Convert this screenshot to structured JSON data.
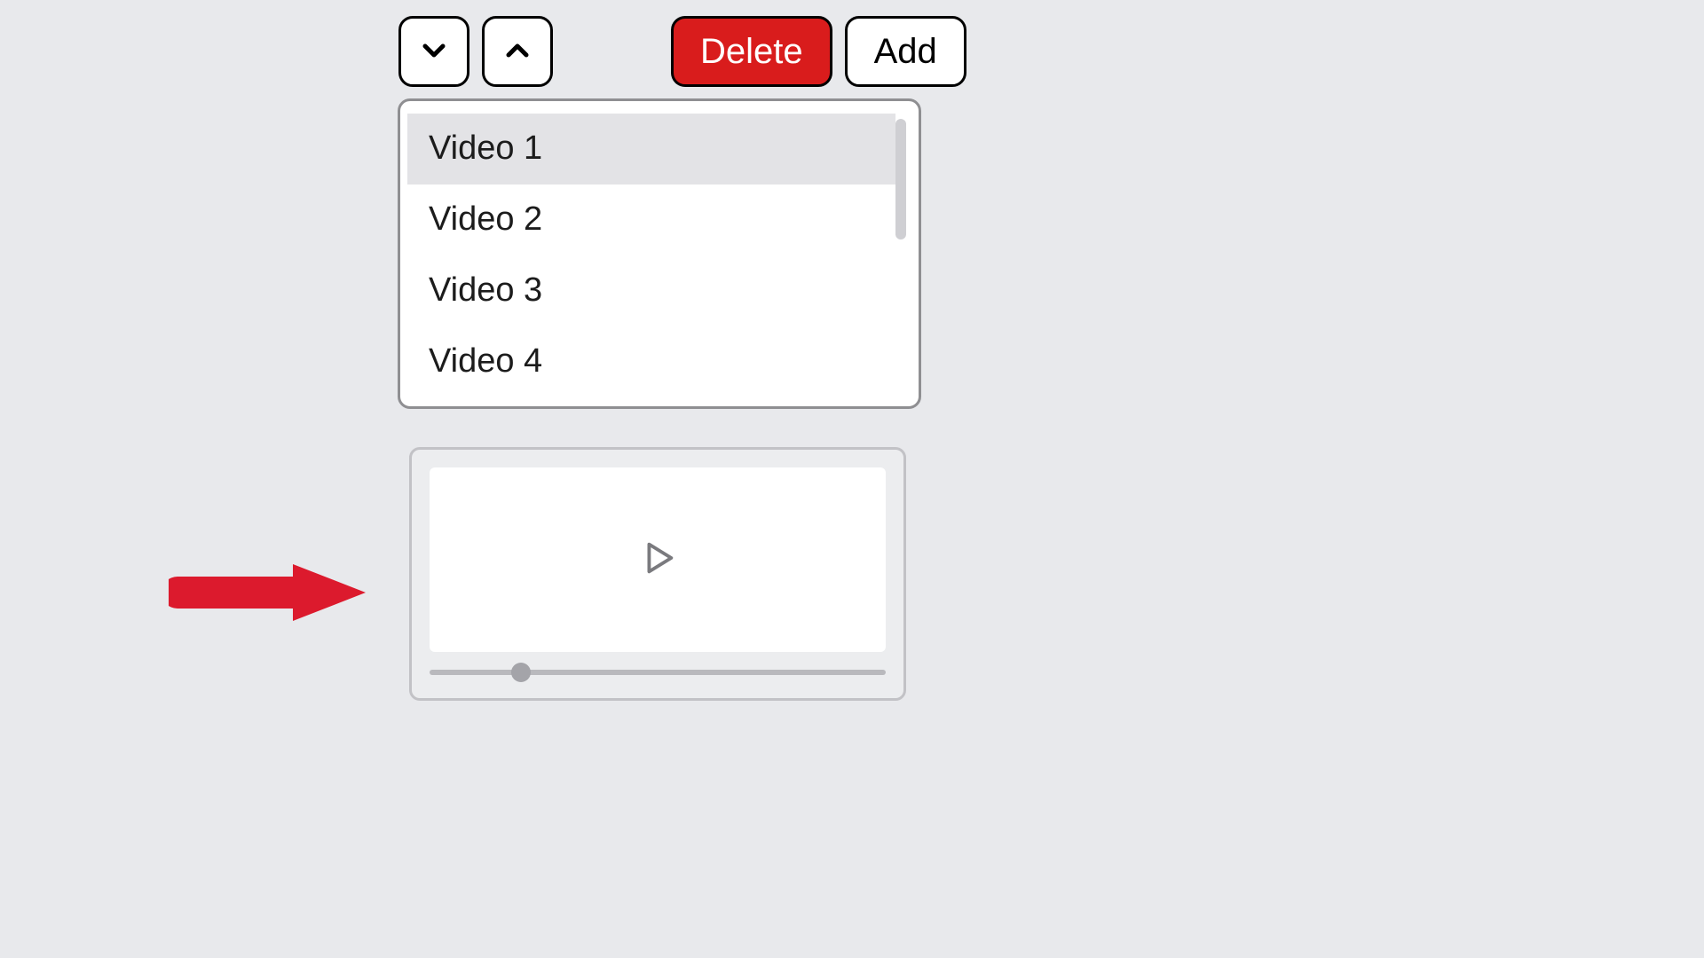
{
  "toolbar": {
    "delete_label": "Delete",
    "add_label": "Add"
  },
  "playlist": {
    "items": [
      {
        "label": "Video 1",
        "selected": true
      },
      {
        "label": "Video 2",
        "selected": false
      },
      {
        "label": "Video 3",
        "selected": false
      },
      {
        "label": "Video 4",
        "selected": false
      }
    ]
  },
  "player": {
    "progress_percent": 20
  },
  "colors": {
    "danger": "#d91c1c",
    "annotation": "#dc1a2d"
  }
}
